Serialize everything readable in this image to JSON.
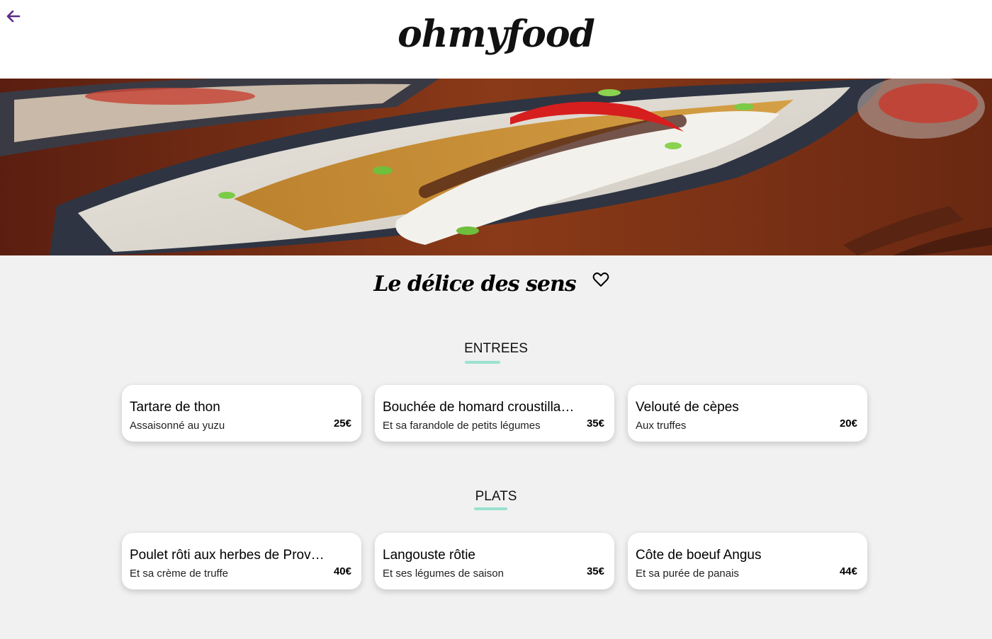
{
  "header": {
    "logo": "ohmyfood",
    "back_icon": "arrow-left-icon"
  },
  "colors": {
    "accent_purple": "#5b2a86",
    "section_underline": "#99e2d0",
    "background": "#f1f1f1"
  },
  "restaurant": {
    "name": "Le délice des sens",
    "favorite_icon": "heart-outline-icon"
  },
  "sections": [
    {
      "title": "ENTREES",
      "dishes": [
        {
          "name": "Tartare de thon",
          "description": "Assaisonné au yuzu",
          "price": "25€"
        },
        {
          "name": "Bouchée de homard croustillante",
          "description": "Et sa farandole de petits légumes",
          "price": "35€"
        },
        {
          "name": "Velouté de cèpes",
          "description": "Aux truffes",
          "price": "20€"
        }
      ]
    },
    {
      "title": "PLATS",
      "dishes": [
        {
          "name": "Poulet rôti aux herbes de Provence",
          "description": "Et sa crème de truffe",
          "price": "40€"
        },
        {
          "name": "Langouste rôtie",
          "description": "Et ses légumes de saison",
          "price": "35€"
        },
        {
          "name": "Côte de boeuf Angus",
          "description": "Et sa purée de panais",
          "price": "44€"
        }
      ]
    }
  ]
}
